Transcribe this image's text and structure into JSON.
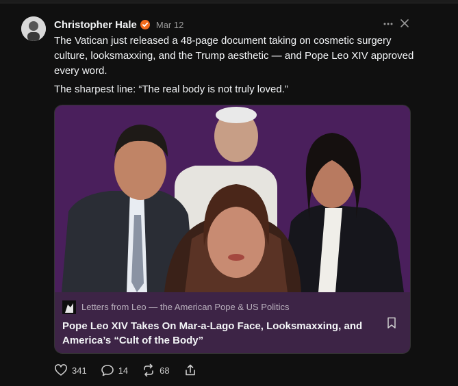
{
  "post": {
    "author": "Christopher Hale",
    "timestamp": "Mar 12",
    "paragraphs": [
      "The Vatican just released a 48-page document taking on cosmetic surgery culture, looksmaxxing, and the Trump aesthetic — and Pope Leo XIV approved every word.",
      "The sharpest line: “The real body is not truly loved.”"
    ],
    "icons": {
      "verified": "verified-badge-icon",
      "more": "more-options-icon",
      "close": "close-icon"
    }
  },
  "card": {
    "source": "Letters from Leo — the American Pope & US Politics",
    "title": "Pope Leo XIV Takes On Mar-a-Lago Face, Looksmaxxing, and America’s “Cult of the Body”",
    "colors": {
      "image_bg": "#4a1f5c",
      "meta_bg": "#3d2446"
    }
  },
  "actions": {
    "likes": "341",
    "replies": "14",
    "reposts": "68",
    "icons": [
      "heart-icon",
      "reply-icon",
      "repost-icon",
      "share-icon"
    ]
  },
  "colors": {
    "accent_verified": "#f26b1d",
    "page_bg": "#101010"
  }
}
